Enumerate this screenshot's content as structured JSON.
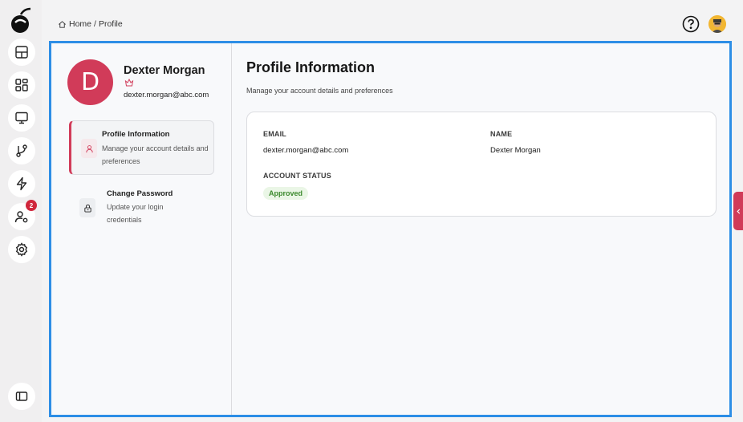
{
  "breadcrumb": {
    "home": "Home",
    "separator": "/",
    "current": "Profile"
  },
  "rail": {
    "items": [
      {
        "icon": "grid-layout-icon"
      },
      {
        "icon": "dashboard-icon"
      },
      {
        "icon": "monitor-icon"
      },
      {
        "icon": "git-branch-icon"
      },
      {
        "icon": "lightning-icon"
      },
      {
        "icon": "user-settings-icon",
        "badge": "2"
      },
      {
        "icon": "gear-icon"
      }
    ],
    "bottom_icon": "sidebar-toggle-icon"
  },
  "profile": {
    "initial": "D",
    "name": "Dexter Morgan",
    "email": "dexter.morgan@abc.com",
    "avatar_color": "#d13b59"
  },
  "menu": {
    "items": [
      {
        "title": "Profile Information",
        "description": "Manage your account details and preferences"
      },
      {
        "title": "Change Password",
        "description": "Update your login credentials"
      }
    ]
  },
  "content": {
    "title": "Profile Information",
    "subtitle": "Manage your account details and preferences",
    "fields": {
      "email_label": "EMAIL",
      "email_value": "dexter.morgan@abc.com",
      "name_label": "NAME",
      "name_value": "Dexter Morgan",
      "status_label": "ACCOUNT STATUS",
      "status_value": "Approved"
    }
  },
  "colors": {
    "accent": "#d13b59",
    "frame": "#2d8ee6",
    "success": "#3c8a2e"
  }
}
